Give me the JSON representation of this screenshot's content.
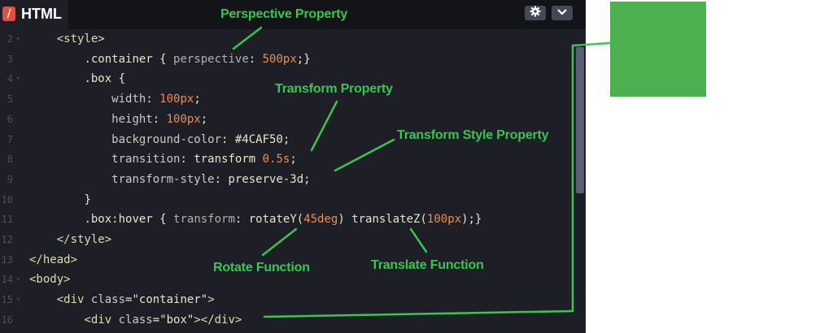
{
  "header": {
    "lang_icon": "/",
    "title": "HTML",
    "settings_icon": "gear-icon",
    "collapse_icon": "chevron-down-icon"
  },
  "code_lines": [
    {
      "n": "2",
      "fold": true,
      "indent": "    ",
      "tokens": [
        {
          "t": "<style>",
          "c": "tag"
        }
      ]
    },
    {
      "n": "3",
      "fold": false,
      "indent": "        ",
      "tokens": [
        {
          "t": ".container",
          "c": "sel"
        },
        {
          "t": " { ",
          "c": "punc"
        },
        {
          "t": "perspective",
          "c": "dim"
        },
        {
          "t": ": ",
          "c": "punc"
        },
        {
          "t": "500px",
          "c": "num"
        },
        {
          "t": ";}",
          "c": "punc"
        }
      ]
    },
    {
      "n": "4",
      "fold": true,
      "indent": "        ",
      "tokens": [
        {
          "t": ".box",
          "c": "sel"
        },
        {
          "t": " {",
          "c": "punc"
        }
      ]
    },
    {
      "n": "5",
      "fold": false,
      "indent": "            ",
      "tokens": [
        {
          "t": "width",
          "c": "prop"
        },
        {
          "t": ": ",
          "c": "punc"
        },
        {
          "t": "100px",
          "c": "num"
        },
        {
          "t": ";",
          "c": "punc"
        }
      ]
    },
    {
      "n": "6",
      "fold": false,
      "indent": "            ",
      "tokens": [
        {
          "t": "height",
          "c": "prop"
        },
        {
          "t": ": ",
          "c": "punc"
        },
        {
          "t": "100px",
          "c": "num"
        },
        {
          "t": ";",
          "c": "punc"
        }
      ]
    },
    {
      "n": "7",
      "fold": false,
      "indent": "            ",
      "tokens": [
        {
          "t": "background-color",
          "c": "prop"
        },
        {
          "t": ": ",
          "c": "punc"
        },
        {
          "t": "#4CAF50",
          "c": "val"
        },
        {
          "t": ";",
          "c": "punc"
        }
      ]
    },
    {
      "n": "8",
      "fold": false,
      "indent": "            ",
      "tokens": [
        {
          "t": "transition",
          "c": "prop"
        },
        {
          "t": ": ",
          "c": "punc"
        },
        {
          "t": "transform ",
          "c": "val"
        },
        {
          "t": "0.5s",
          "c": "num"
        },
        {
          "t": ";",
          "c": "punc"
        }
      ]
    },
    {
      "n": "9",
      "fold": false,
      "indent": "            ",
      "tokens": [
        {
          "t": "transform-style",
          "c": "prop"
        },
        {
          "t": ": ",
          "c": "punc"
        },
        {
          "t": "preserve-3d",
          "c": "val"
        },
        {
          "t": ";",
          "c": "punc"
        }
      ]
    },
    {
      "n": "10",
      "fold": false,
      "indent": "        ",
      "tokens": [
        {
          "t": "}",
          "c": "punc"
        }
      ]
    },
    {
      "n": "11",
      "fold": false,
      "indent": "        ",
      "tokens": [
        {
          "t": ".box:hover",
          "c": "sel"
        },
        {
          "t": " { ",
          "c": "punc"
        },
        {
          "t": "transform",
          "c": "dim"
        },
        {
          "t": ": ",
          "c": "punc"
        },
        {
          "t": "rotateY(",
          "c": "val"
        },
        {
          "t": "45deg",
          "c": "num"
        },
        {
          "t": ") translateZ(",
          "c": "val"
        },
        {
          "t": "100px",
          "c": "num"
        },
        {
          "t": ");}",
          "c": "punc"
        }
      ]
    },
    {
      "n": "12",
      "fold": false,
      "indent": "    ",
      "tokens": [
        {
          "t": "</style>",
          "c": "tag"
        }
      ]
    },
    {
      "n": "13",
      "fold": false,
      "indent": "",
      "tokens": [
        {
          "t": "</head>",
          "c": "tag"
        }
      ]
    },
    {
      "n": "14",
      "fold": true,
      "indent": "",
      "tokens": [
        {
          "t": "<body>",
          "c": "tag"
        }
      ]
    },
    {
      "n": "15",
      "fold": true,
      "indent": "    ",
      "tokens": [
        {
          "t": "<div ",
          "c": "tag"
        },
        {
          "t": "class",
          "c": "prop"
        },
        {
          "t": "=",
          "c": "punc"
        },
        {
          "t": "\"container\"",
          "c": "str"
        },
        {
          "t": ">",
          "c": "tag"
        }
      ]
    },
    {
      "n": "16",
      "fold": false,
      "indent": "        ",
      "tokens": [
        {
          "t": "<div ",
          "c": "tag"
        },
        {
          "t": "class",
          "c": "prop"
        },
        {
          "t": "=",
          "c": "punc"
        },
        {
          "t": "\"box\"",
          "c": "str"
        },
        {
          "t": "></div>",
          "c": "tag"
        }
      ]
    }
  ],
  "annotations": {
    "perspective": "Perspective Property",
    "transform": "Transform Property",
    "transform_style": "Transform Style Property",
    "rotate": "Rotate Function",
    "translate": "Translate Function"
  },
  "colors": {
    "annotation": "#39c552",
    "preview_box": "#4caf50",
    "editor_bg": "#1e1f26"
  }
}
